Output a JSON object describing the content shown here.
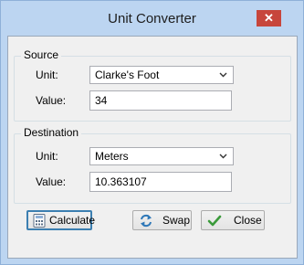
{
  "window": {
    "title": "Unit Converter",
    "close_glyph": "✕"
  },
  "source": {
    "group_label": "Source",
    "unit_label": "Unit:",
    "unit_value": "Clarke's Foot",
    "value_label": "Value:",
    "value": "34"
  },
  "destination": {
    "group_label": "Destination",
    "unit_label": "Unit:",
    "unit_value": "Meters",
    "value_label": "Value:",
    "value": "10.363107"
  },
  "buttons": {
    "calculate": "Calculate",
    "swap": "Swap",
    "close": "Close"
  },
  "icons": {
    "dropdown": "chevron-down-icon",
    "calculate": "calculator-icon",
    "swap": "swap-arrows-icon",
    "close": "checkmark-icon"
  },
  "colors": {
    "titlebar": "#bcd5f1",
    "close_button": "#c7463c",
    "focus_border": "#3c7fb1"
  }
}
